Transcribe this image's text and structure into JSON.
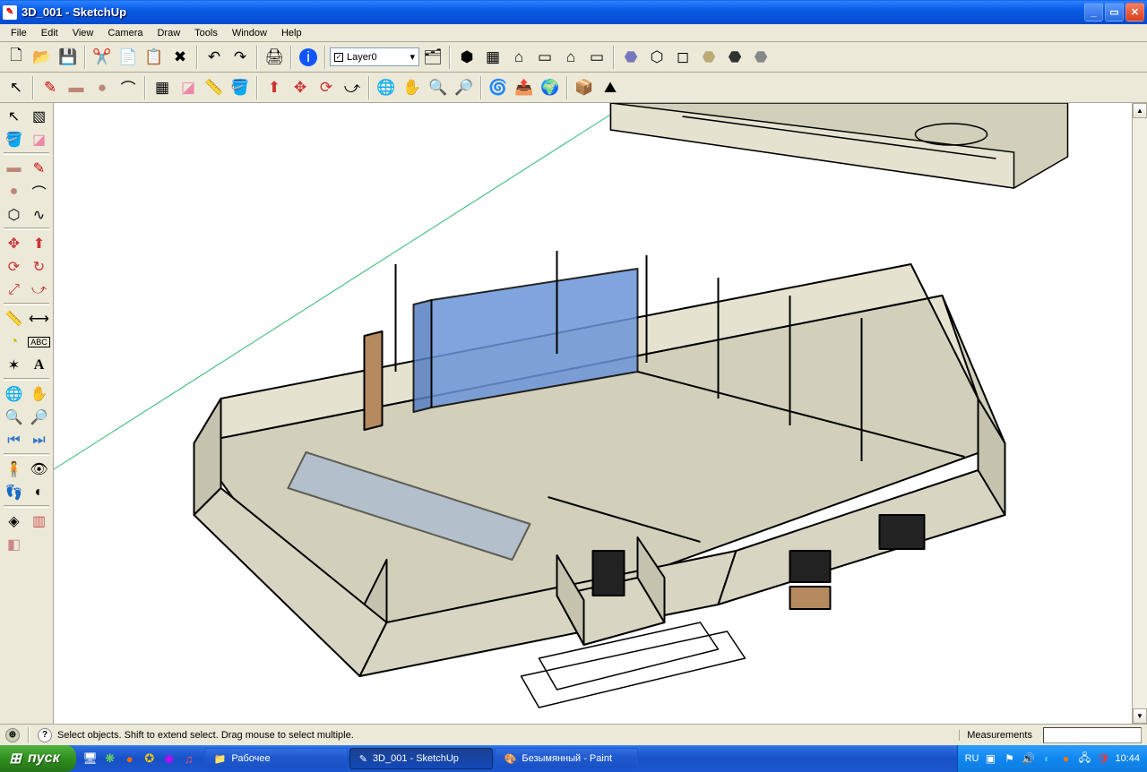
{
  "window": {
    "title": "3D_001 - SketchUp"
  },
  "menubar": [
    "File",
    "Edit",
    "View",
    "Camera",
    "Draw",
    "Tools",
    "Window",
    "Help"
  ],
  "layer": {
    "current": "Layer0"
  },
  "statusbar": {
    "hint": "Select objects. Shift to extend select. Drag mouse to select multiple.",
    "measurements_label": "Measurements"
  },
  "taskbar": {
    "start": "пуск",
    "items": [
      {
        "label": "Рабочее",
        "active": false
      },
      {
        "label": "3D_001 - SketchUp",
        "active": true
      },
      {
        "label": "Безымянный - Paint",
        "active": false
      }
    ],
    "tray": {
      "lang": "RU",
      "time": "10:44"
    }
  }
}
